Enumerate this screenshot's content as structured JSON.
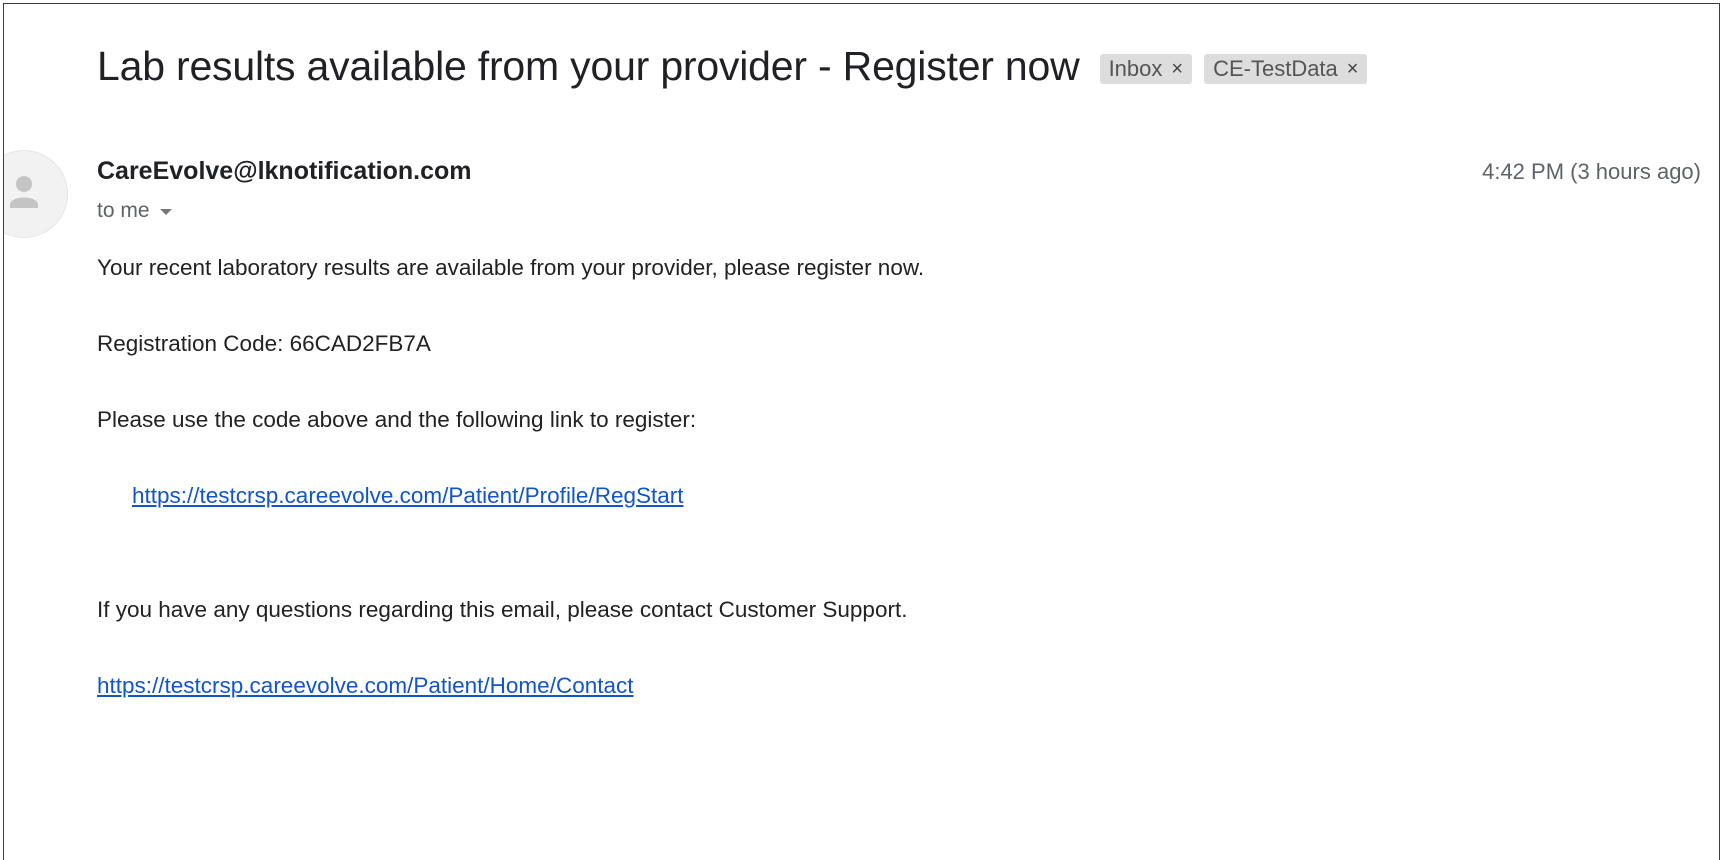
{
  "email": {
    "subject": "Lab results available from your provider - Register now",
    "labels": [
      {
        "name": "Inbox",
        "close": "×"
      },
      {
        "name": "CE-TestData",
        "close": "×"
      }
    ],
    "sender": "CareEvolve@lknotification.com",
    "timestamp": "4:42 PM (3 hours ago)",
    "recipient": "to me",
    "body": {
      "intro": "Your recent laboratory results are available from your provider, please register now.",
      "registration_code_line": "Registration Code:  66CAD2FB7A",
      "instructions": "Please use the code above and the following link to register:",
      "register_link": "https://testcrsp.careevolve.com/Patient/Profile/RegStart",
      "support_text": "If you have any questions regarding this email, please contact Customer Support.",
      "contact_link": "https://testcrsp.careevolve.com/Patient/Home/Contact"
    }
  },
  "icons": {
    "avatar": "person-icon",
    "recipient_toggle": "caret-down-icon",
    "label_remove": "close-icon"
  },
  "colors": {
    "link": "#1155cc",
    "label_bg": "#dddddd",
    "muted_text": "#5f6368"
  }
}
